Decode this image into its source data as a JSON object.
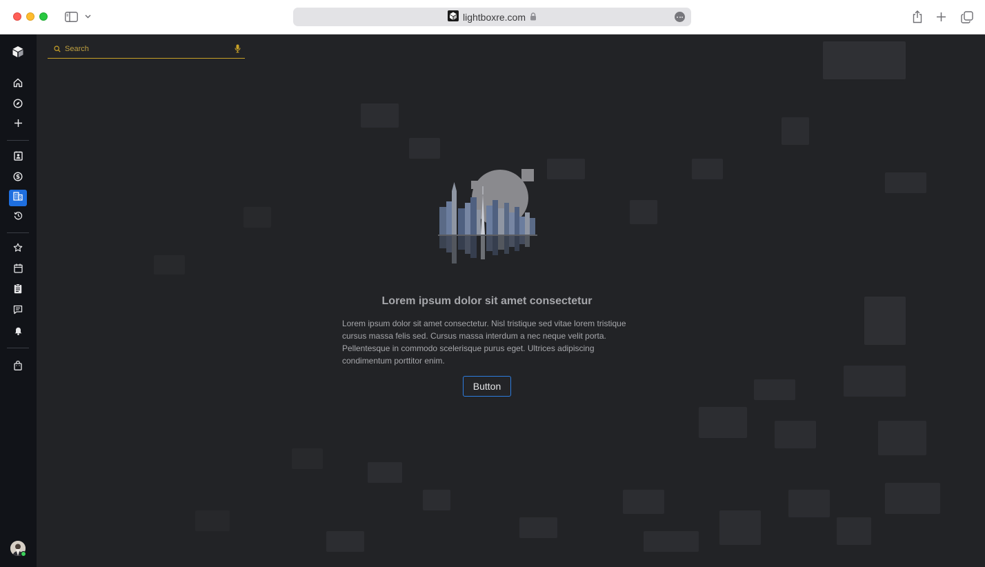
{
  "browser": {
    "url": "lightboxre.com"
  },
  "sidebar": {
    "items": [
      {
        "name": "home"
      },
      {
        "name": "explore"
      },
      {
        "name": "add"
      },
      {
        "name": "contacts"
      },
      {
        "name": "finance"
      },
      {
        "name": "properties",
        "active": true
      },
      {
        "name": "history"
      },
      {
        "name": "favorites"
      },
      {
        "name": "calendar"
      },
      {
        "name": "tasks"
      },
      {
        "name": "messages"
      },
      {
        "name": "notifications"
      },
      {
        "name": "marketplace"
      }
    ]
  },
  "search": {
    "placeholder": "Search"
  },
  "empty_state": {
    "title": "Lorem ipsum dolor sit amet consectetur",
    "description": "Lorem ipsum dolor sit amet consectetur. Nisl tristique sed vitae lorem tristique cursus massa felis sed. Cursus massa interdum a nec neque velit porta. Pellentesque in commodo scelerisque purus eget. Ultrices adipiscing condimentum porttitor enim.",
    "button_label": "Button"
  },
  "colors": {
    "accent": "#1e6fe0",
    "search_underline": "#c9a227",
    "sidebar_bg": "#111318"
  }
}
